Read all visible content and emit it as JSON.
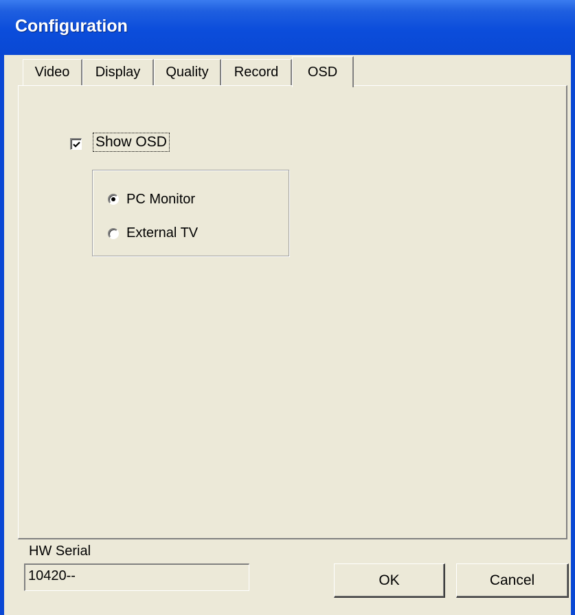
{
  "window": {
    "title": "Configuration"
  },
  "tabs": [
    {
      "label": "Video",
      "active": false
    },
    {
      "label": "Display",
      "active": false
    },
    {
      "label": "Quality",
      "active": false
    },
    {
      "label": "Record",
      "active": false
    },
    {
      "label": "OSD",
      "active": true
    }
  ],
  "osd": {
    "show_osd": {
      "label": "Show OSD",
      "checked": true
    },
    "output": {
      "options": [
        {
          "label": "PC Monitor",
          "selected": true
        },
        {
          "label": "External TV",
          "selected": false
        }
      ]
    }
  },
  "hw_serial": {
    "label": "HW Serial",
    "value": "10420--"
  },
  "buttons": {
    "ok": "OK",
    "cancel": "Cancel"
  }
}
